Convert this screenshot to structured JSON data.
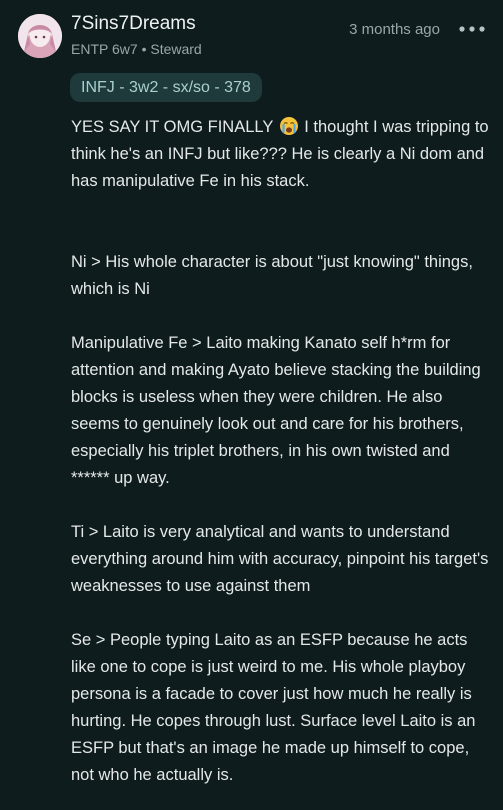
{
  "post": {
    "username": "7Sins7Dreams",
    "type": "ENTP 6w7",
    "separator": "•",
    "role": "Steward",
    "timestamp": "3 months ago",
    "badge": "INFJ - 3w2 - sx/so - 378",
    "paragraphs": {
      "p1_before_emoji": "YES SAY IT OMG FINALLY ",
      "p1_after_emoji": " I thought I was tripping to think he's an INFJ but like??? He is clearly a Ni dom and has manipulative Fe in his stack.",
      "p2": "Ni > His whole character is about \"just knowing\" things, which is Ni",
      "p3": "Manipulative Fe > Laito making Kanato self h*rm for attention and making Ayato believe stacking the building blocks is useless when they were children. He also seems to genuinely look out and care for his brothers, especially his triplet brothers, in his own twisted and ****** up way.",
      "p4": "Ti > Laito is very analytical and wants to understand everything around him with accuracy, pinpoint his target's weaknesses to use against them",
      "p5": "Se > People typing Laito as an ESFP because he acts like one to cope is just weird to me. His whole playboy persona is a facade to cover just how much he really is hurting. He copes through lust. Surface level Laito is an ESFP but that's an image he made up himself to cope, not who he actually is."
    }
  },
  "icons": {
    "avatar": "user-avatar",
    "more": "more-options-icon",
    "emoji": "crying-face-emoji"
  },
  "colors": {
    "background": "#0f1c1d",
    "badge_bg": "#1e3a3b",
    "badge_text": "#a9cfd0",
    "muted_text": "#9aa6a7"
  }
}
